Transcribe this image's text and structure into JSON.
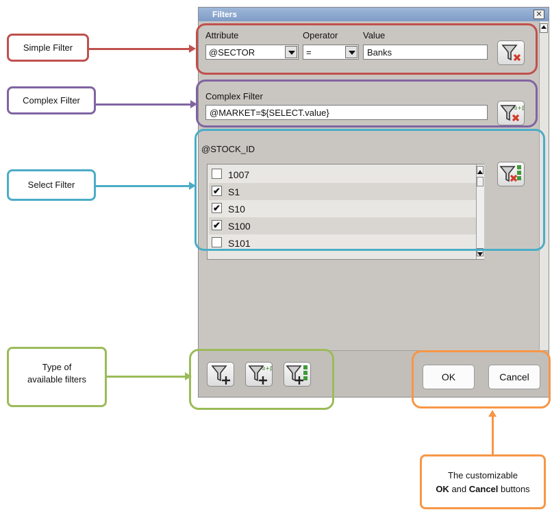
{
  "dialog": {
    "title": "Filters",
    "close_glyph": "✕",
    "simple": {
      "attribute_label": "Attribute",
      "operator_label": "Operator",
      "value_label": "Value",
      "attribute_value": "@SECTOR",
      "operator_value": "=",
      "value_value": "Banks"
    },
    "complex": {
      "label": "Complex Filter",
      "value": "@MARKET=${SELECT.value}"
    },
    "select": {
      "label": "@STOCK_ID",
      "items": [
        {
          "text": "1007",
          "checked": false
        },
        {
          "text": "S1",
          "checked": true
        },
        {
          "text": "S10",
          "checked": true
        },
        {
          "text": "S100",
          "checked": true
        },
        {
          "text": "S101",
          "checked": false
        }
      ]
    },
    "buttons": {
      "ok": "OK",
      "cancel": "Cancel"
    }
  },
  "annotations": {
    "simple": "Simple Filter",
    "complex": "Complex Filter",
    "select": "Select Filter",
    "types_line1": "Type of",
    "types_line2": "available filters",
    "buttons_line1": "The customizable",
    "buttons_ok": "OK",
    "buttons_and": "and",
    "buttons_cancel": "Cancel",
    "buttons_tail": "buttons"
  },
  "colors": {
    "simple": "#c0504d",
    "complex": "#8064a2",
    "select": "#4bacc6",
    "types": "#9bbb59",
    "buttons": "#f79646"
  },
  "icons": {
    "remove_simple": "funnel-remove-icon",
    "remove_complex": "funnel-alpha-beta-remove-icon",
    "remove_select": "funnel-list-remove-icon",
    "add_simple": "funnel-add-icon",
    "add_complex": "funnel-alpha-beta-add-icon",
    "add_select": "funnel-list-add-icon"
  }
}
